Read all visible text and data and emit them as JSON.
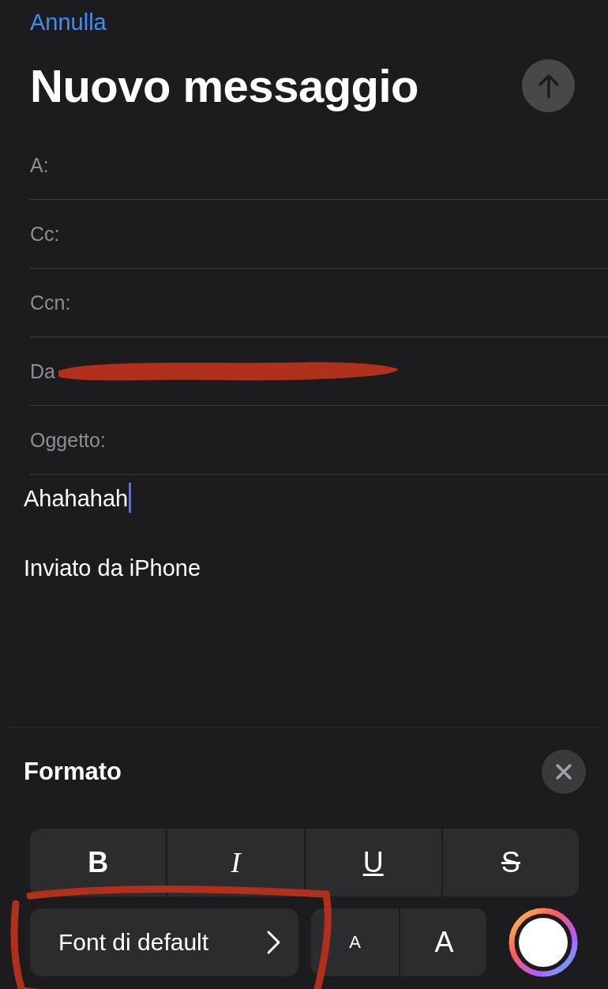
{
  "nav": {
    "cancel": "Annulla"
  },
  "title": "Nuovo messaggio",
  "send_button": {
    "disabled": true
  },
  "fields": [
    {
      "label": "A:",
      "redacted": false
    },
    {
      "label": "Cc:",
      "redacted": false
    },
    {
      "label": "Ccn:",
      "redacted": false
    },
    {
      "label": "Da",
      "redacted": true
    },
    {
      "label": "Oggetto:",
      "redacted": false
    }
  ],
  "body": [
    {
      "text": "Ahahahah",
      "cursor": true
    },
    {
      "text": "Inviato da iPhone",
      "cursor": false
    }
  ],
  "format_panel": {
    "title": "Formato",
    "style_buttons": [
      {
        "label": "B",
        "kind": "bold"
      },
      {
        "label": "I",
        "kind": "italic"
      },
      {
        "label": "U",
        "kind": "underline"
      },
      {
        "label": "S",
        "kind": "strike"
      }
    ],
    "font_button": {
      "label": "Font di default",
      "circled": true
    },
    "size_buttons": [
      {
        "label": "A",
        "kind": "smaller"
      },
      {
        "label": "A",
        "kind": "larger"
      }
    ]
  }
}
